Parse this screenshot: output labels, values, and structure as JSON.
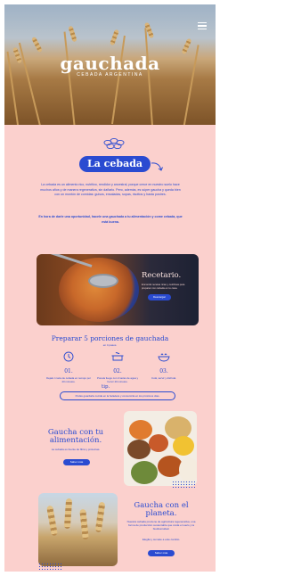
{
  "hero": {
    "logo": "gauchada",
    "tagline": "CEBADA ARGENTINA"
  },
  "intro": {
    "pill_title": "La cebada",
    "paragraph_1": "La cebada es un alimento rico, nutritivo, rendidor y ancestral, porque crece en nuestro suelo hace muchos años y de manera regenerativa, sin dañarlo. Pero, además, es súper gaucha y queda bien con un montón de comidas: guisos, ensaladas, sopas, risottos y hasta postres.",
    "paragraph_2": "En hora de darle una oportunidad, hacele una gauchada a tu alimentación y come cebada, que está buena."
  },
  "recetario": {
    "title": "Recetario.",
    "description": "Encontrá recetas ricas y nutritivas para preparar con cebada en tu casa.",
    "button": "Descargar"
  },
  "portions": {
    "title": "Preparar 5 porciones de gauchada",
    "subtitle": "en 4 pasos.",
    "items": [
      {
        "num": "01.",
        "text": "Dejalo 1 taza de cebada en remojo por 20 minutos."
      },
      {
        "num": "02.",
        "text": "Ponela fuego con 4 tazas de agua y hervir 40 minutos."
      },
      {
        "num": "03.",
        "text": "Colá, servir y disfrutá."
      }
    ],
    "tip_label": "tip.",
    "tip_text": "Podés guardarla cocida en la heladera y consumirla en los próximos días."
  },
  "card_alimentacion": {
    "title": "Gaucha con tu alimentación.",
    "description": "La cebada es fuente de fibra y proteínas.",
    "button": "Saber más"
  },
  "card_planeta": {
    "title": "Gaucha con el planeta.",
    "description": "Nuestra cebada proviene de agricultura regenerativa, una forma de producción sustentable que cuida el suelo y la biodiversidad.",
    "description_2": "Elegila y sumate a este cambio.",
    "button": "Saber más"
  },
  "colors": {
    "background": "#fbd0cd",
    "brand_blue": "#2a4bd1"
  }
}
